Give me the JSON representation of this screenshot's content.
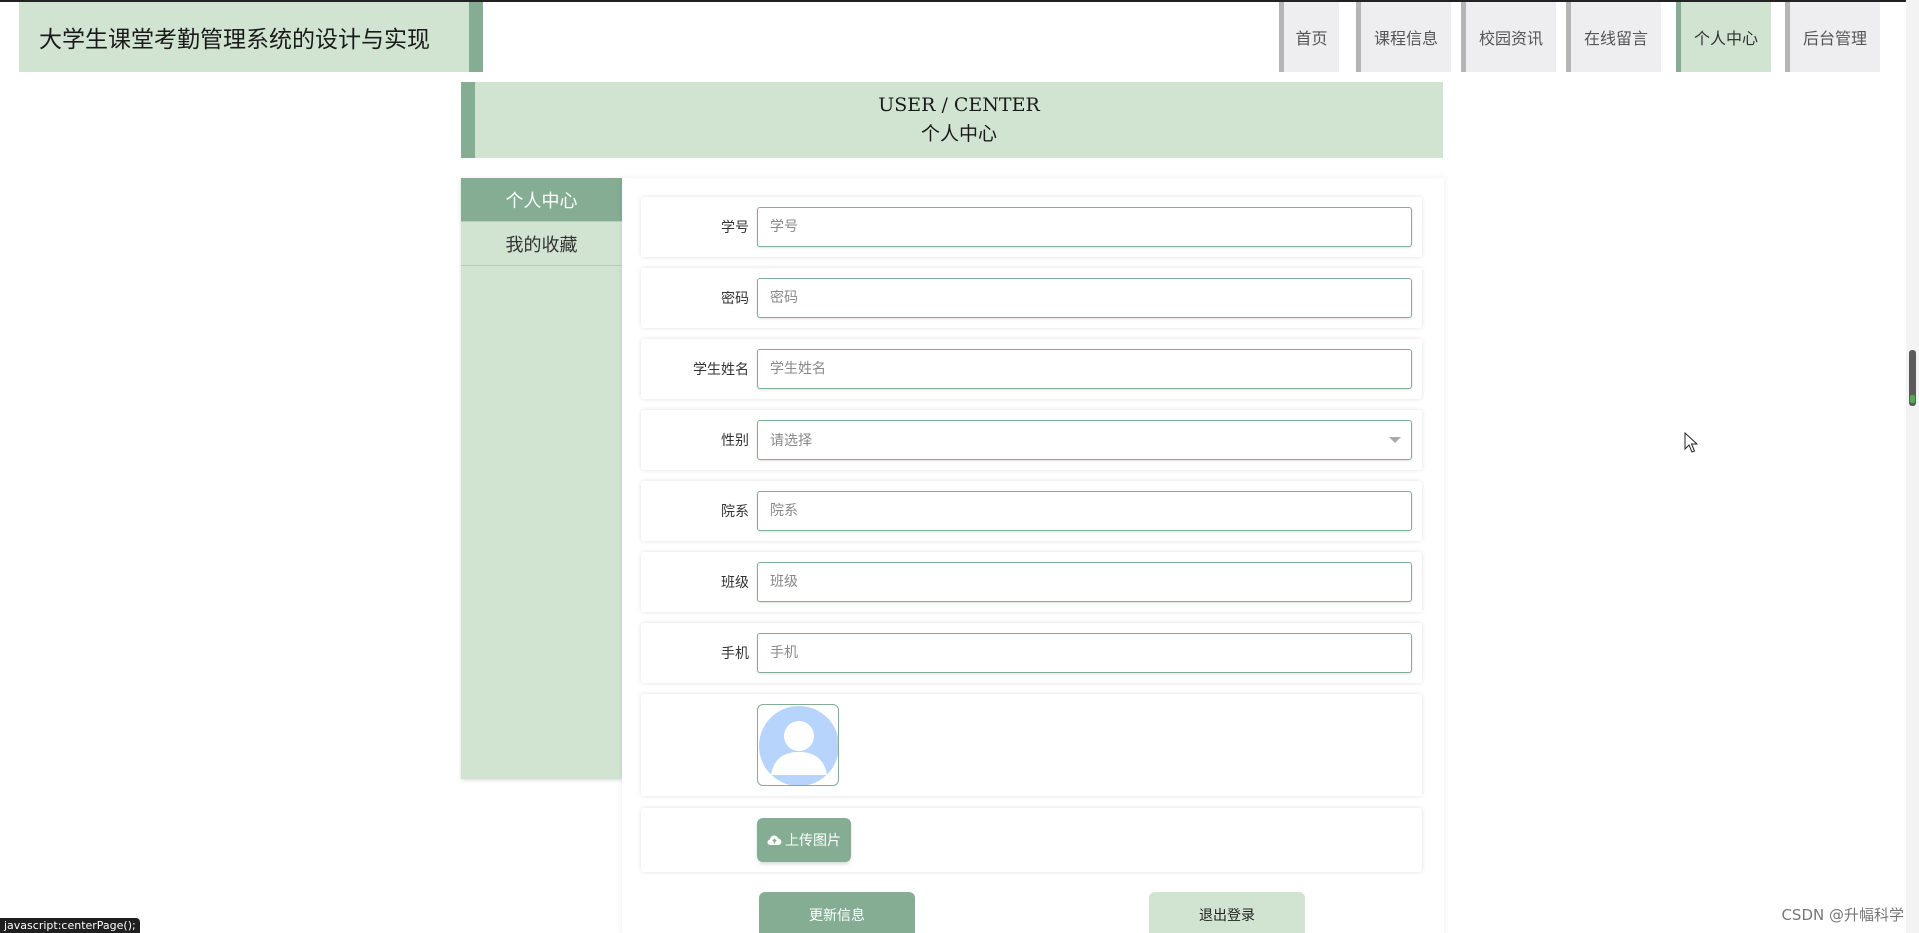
{
  "header": {
    "title": "大学生课堂考勤管理系统的设计与实现",
    "nav": [
      {
        "label": "首页",
        "active": false
      },
      {
        "label": "课程信息",
        "active": false
      },
      {
        "label": "校园资讯",
        "active": false
      },
      {
        "label": "在线留言",
        "active": false
      },
      {
        "label": "个人中心",
        "active": true
      },
      {
        "label": "后台管理",
        "active": false
      }
    ]
  },
  "banner": {
    "en": "USER / CENTER",
    "cn": "个人中心"
  },
  "sidebar": {
    "items": [
      {
        "label": "个人中心",
        "active": true
      },
      {
        "label": "我的收藏",
        "active": false
      }
    ]
  },
  "form": {
    "student_id": {
      "label": "学号",
      "placeholder": "学号"
    },
    "password": {
      "label": "密码",
      "placeholder": "密码"
    },
    "name": {
      "label": "学生姓名",
      "placeholder": "学生姓名"
    },
    "gender": {
      "label": "性别",
      "value": "请选择"
    },
    "department": {
      "label": "院系",
      "placeholder": "院系"
    },
    "class": {
      "label": "班级",
      "placeholder": "班级"
    },
    "phone": {
      "label": "手机",
      "placeholder": "手机"
    },
    "upload_label": "上传图片",
    "update_label": "更新信息",
    "logout_label": "退出登录"
  },
  "status_bar": "javascript:centerPage();",
  "watermark": "CSDN @升幅科学",
  "colors": {
    "accent": "#84ad94",
    "accent_light": "#d1e4d1",
    "nav_bg": "#eeedf0"
  }
}
